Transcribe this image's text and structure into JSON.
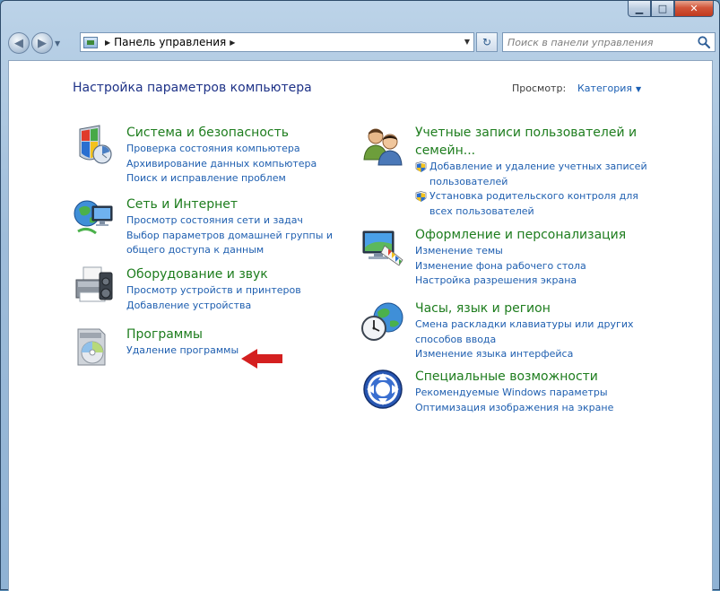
{
  "window": {
    "controls": {
      "minimize": "▁",
      "maximize": "□",
      "close": "✕"
    }
  },
  "toolbar": {
    "back": "◀",
    "forward": "▶",
    "address": {
      "breadcrumb": "Панель управления",
      "separator": "▶"
    },
    "refresh": "↻",
    "search": {
      "placeholder": "Поиск в панели управления"
    }
  },
  "header": {
    "title": "Настройка параметров компьютера",
    "view_label": "Просмотр:",
    "view_value": "Категория"
  },
  "categories": [
    {
      "title": "Система и безопасность",
      "icon": "security-shield-icon",
      "links": [
        "Проверка состояния компьютера",
        "Архивирование данных компьютера",
        "Поиск и исправление проблем"
      ]
    },
    {
      "title": "Сеть и Интернет",
      "icon": "network-globe-icon",
      "links": [
        "Просмотр состояния сети и задач",
        "Выбор параметров домашней группы и",
        "общего доступа к данным"
      ]
    },
    {
      "title": "Оборудование и звук",
      "icon": "printer-icon",
      "links": [
        "Просмотр устройств и принтеров",
        "Добавление устройства"
      ]
    },
    {
      "title": "Программы",
      "icon": "programs-disc-icon",
      "links": [
        "Удаление программы"
      ]
    },
    {
      "title_line1": "Учетные записи пользователей и",
      "title_line2": "семейн...",
      "icon": "users-icon",
      "links": [
        "Добавление и удаление учетных записей",
        "пользователей",
        "Установка родительского контроля для",
        "всех пользователей"
      ]
    },
    {
      "title": "Оформление и персонализация",
      "icon": "monitor-palette-icon",
      "links": [
        "Изменение темы",
        "Изменение фона рабочего стола",
        "Настройка разрешения экрана"
      ]
    },
    {
      "title": "Часы, язык и регион",
      "icon": "clock-globe-icon",
      "links": [
        "Смена раскладки клавиатуры или других",
        "способов ввода",
        "Изменение языка интерфейса"
      ]
    },
    {
      "title": "Специальные возможности",
      "icon": "accessibility-icon",
      "links": [
        "Рекомендуемые Windows параметры",
        "Оптимизация изображения на экране"
      ]
    }
  ],
  "annotation": {
    "icon": "red-arrow-icon",
    "color": "#d42020"
  },
  "colors": {
    "category_title": "#1e7d1e",
    "link": "#1f5fb0",
    "page_title": "#1e3287"
  }
}
